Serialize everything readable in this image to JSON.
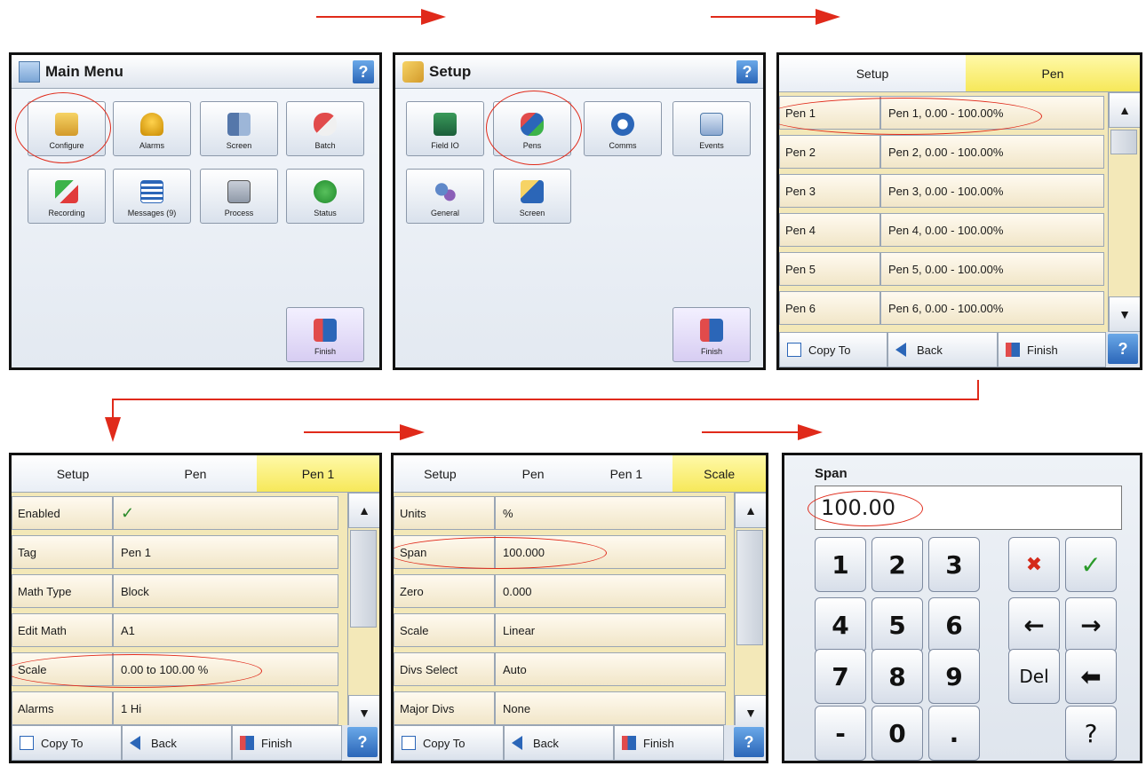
{
  "panel1": {
    "title": "Main Menu",
    "help": "?",
    "buttons": [
      "Configure",
      "Alarms",
      "Screen",
      "Batch",
      "Recording",
      "Messages (9)",
      "Process",
      "Status"
    ],
    "finish": "Finish"
  },
  "panel2": {
    "title": "Setup",
    "help": "?",
    "buttons": [
      "Field IO",
      "Pens",
      "Comms",
      "Events",
      "General",
      "Screen"
    ],
    "finish": "Finish"
  },
  "panel3": {
    "crumbs": [
      "Setup",
      "Pen"
    ],
    "rows": [
      {
        "k": "Pen 1",
        "v": "Pen 1, 0.00 - 100.00%"
      },
      {
        "k": "Pen 2",
        "v": "Pen 2, 0.00 - 100.00%"
      },
      {
        "k": "Pen 3",
        "v": "Pen 3, 0.00 - 100.00%"
      },
      {
        "k": "Pen 4",
        "v": "Pen 4, 0.00 - 100.00%"
      },
      {
        "k": "Pen 5",
        "v": "Pen 5, 0.00 - 100.00%"
      },
      {
        "k": "Pen 6",
        "v": "Pen 6, 0.00 - 100.00%"
      }
    ],
    "bottom": {
      "copy": "Copy To",
      "back": "Back",
      "finish": "Finish",
      "help": "?"
    }
  },
  "panel4": {
    "crumbs": [
      "Setup",
      "Pen",
      "Pen 1"
    ],
    "rows": [
      {
        "k": "Enabled",
        "v": "✓"
      },
      {
        "k": "Tag",
        "v": "Pen 1"
      },
      {
        "k": "Math Type",
        "v": "Block"
      },
      {
        "k": "Edit Math",
        "v": "A1"
      },
      {
        "k": "Scale",
        "v": "0.00 to 100.00 %"
      },
      {
        "k": "Alarms",
        "v": "1 Hi"
      }
    ],
    "bottom": {
      "copy": "Copy To",
      "back": "Back",
      "finish": "Finish",
      "help": "?"
    }
  },
  "panel5": {
    "crumbs": [
      "Setup",
      "Pen",
      "Pen 1",
      "Scale"
    ],
    "rows": [
      {
        "k": "Units",
        "v": "%"
      },
      {
        "k": "Span",
        "v": "100.000"
      },
      {
        "k": "Zero",
        "v": "0.000"
      },
      {
        "k": "Scale",
        "v": "Linear"
      },
      {
        "k": "Divs Select",
        "v": "Auto"
      },
      {
        "k": "Major Divs",
        "v": "None"
      }
    ],
    "bottom": {
      "copy": "Copy To",
      "back": "Back",
      "finish": "Finish",
      "help": "?"
    }
  },
  "panel6": {
    "title": "Span",
    "value": "100.00",
    "keys": [
      "1",
      "2",
      "3",
      "4",
      "5",
      "6",
      "7",
      "8",
      "9",
      "-",
      "0",
      "."
    ],
    "side": {
      "cancel": "✖",
      "ok": "✓",
      "left": "←",
      "right": "→",
      "del": "Del",
      "backspace": "⬅",
      "help": "?"
    }
  },
  "colors": {
    "arrow": "#e02a1a",
    "active_crumb": "#f6e85a",
    "row_bg": "#f1e6c8",
    "help": "#2b66b8"
  }
}
